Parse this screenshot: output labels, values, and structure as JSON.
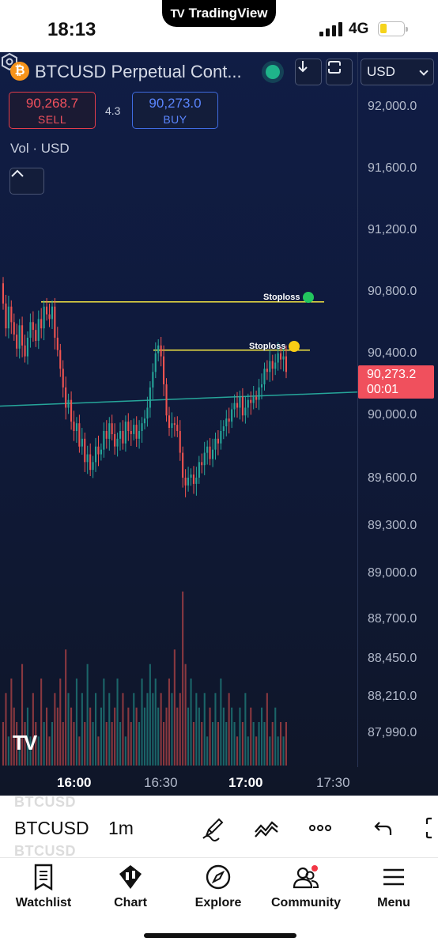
{
  "status_bar": {
    "time": "18:13",
    "island_title": "TradingView",
    "network": "4G"
  },
  "header": {
    "symbol_title": "BTCUSD Perpetual Cont...",
    "coin_glyph": "₿",
    "currency": "USD",
    "sell": {
      "price": "90,268.7",
      "label": "SELL"
    },
    "buy": {
      "price": "90,273.0",
      "label": "BUY"
    },
    "spread": "4.3",
    "vol_label": "Vol · USD"
  },
  "price_axis": {
    "labels": [
      "92,000.0",
      "91,600.0",
      "91,200.0",
      "90,800.0",
      "90,400.0",
      "90,000.0",
      "89,600.0",
      "89,300.0",
      "89,000.0",
      "88,700.0",
      "88,450.0",
      "88,210.0",
      "87,990.0"
    ],
    "current_price": "90,273.2",
    "countdown": "00:01"
  },
  "time_axis": {
    "labels": [
      {
        "text": "16:00",
        "bold": true
      },
      {
        "text": "16:30",
        "bold": false
      },
      {
        "text": "17:00",
        "bold": true
      },
      {
        "text": "17:30",
        "bold": false
      }
    ]
  },
  "annotations": {
    "stoploss_1": {
      "label": "Stoploss",
      "dot_color": "#22c55e"
    },
    "stoploss_2": {
      "label": "Stoploss",
      "dot_color": "#facc15"
    }
  },
  "colors": {
    "up": "#26a69a",
    "down": "#ef5350",
    "stoploss_line": "#f5e642",
    "trendline": "#26a69a",
    "sell": "#f0505d",
    "buy": "#5b86ff"
  },
  "chart_data": {
    "type": "candlestick",
    "series": [
      {
        "name": "BTCUSD",
        "o": [
          90850,
          90720,
          90560,
          90700,
          90600,
          90520,
          90430,
          90580,
          90450,
          90380,
          90500,
          90600,
          90550,
          90480,
          90620,
          90560,
          90700,
          90650,
          90620,
          90700,
          90500,
          90420,
          90300,
          90180,
          90050,
          90100,
          89960,
          89900,
          89950,
          89800,
          89850,
          89700,
          89750,
          89650,
          89700,
          89800,
          89750,
          89780,
          89900,
          89850,
          89950,
          89880,
          89800,
          89850,
          89900,
          89820,
          89960,
          89900,
          89880,
          89940,
          89850,
          89900,
          89950,
          89980,
          90050,
          90180,
          90280,
          90400,
          90450,
          90380,
          90200,
          90000,
          89920,
          89950,
          89940,
          89900,
          89760,
          89600,
          89550,
          89600,
          89620,
          89560,
          89600,
          89700,
          89680,
          89760,
          89800,
          89720,
          89780,
          89850,
          89820,
          89900,
          89930,
          89980,
          89960,
          90040,
          90080,
          90050,
          90120,
          90000,
          90050,
          90100,
          90080,
          90120,
          90100,
          90180,
          90200,
          90300,
          90280,
          90350,
          90300,
          90340,
          90400,
          90360,
          90380
        ],
        "c": [
          90720,
          90560,
          90700,
          90600,
          90520,
          90430,
          90580,
          90450,
          90380,
          90500,
          90600,
          90550,
          90480,
          90620,
          90560,
          90700,
          90650,
          90620,
          90700,
          90500,
          90420,
          90300,
          90180,
          90050,
          90100,
          89960,
          89900,
          89950,
          89800,
          89850,
          89700,
          89750,
          89650,
          89700,
          89800,
          89750,
          89780,
          89900,
          89850,
          89950,
          89880,
          89800,
          89850,
          89900,
          89820,
          89960,
          89900,
          89880,
          89940,
          89850,
          89900,
          89950,
          89980,
          90050,
          90180,
          90280,
          90400,
          90450,
          90380,
          90200,
          90000,
          89920,
          89950,
          89940,
          89900,
          89760,
          89600,
          89550,
          89600,
          89620,
          89560,
          89600,
          89700,
          89680,
          89760,
          89800,
          89720,
          89780,
          89850,
          89820,
          89900,
          89930,
          89980,
          89960,
          90040,
          90080,
          90050,
          90120,
          90000,
          90050,
          90100,
          90080,
          90120,
          90100,
          90180,
          90200,
          90300,
          90280,
          90350,
          90300,
          90340,
          90400,
          90360,
          90380,
          90280
        ]
      }
    ],
    "price_range": [
      87900,
      92100
    ],
    "horizontal_levels": [
      {
        "label": "Stoploss",
        "price": 90730
      },
      {
        "label": "Stoploss",
        "price": 90420
      }
    ],
    "trendline": {
      "from_price": 90060,
      "to_price": 90150
    },
    "volume": [
      3,
      5,
      2,
      6,
      4,
      3,
      2,
      7,
      3,
      4,
      2,
      5,
      3,
      2,
      6,
      3,
      4,
      2,
      3,
      5,
      4,
      6,
      3,
      8,
      5,
      4,
      3,
      6,
      2,
      5,
      3,
      7,
      4,
      3,
      5,
      2,
      4,
      6,
      3,
      5,
      3,
      4,
      6,
      3,
      5,
      2,
      4,
      3,
      5,
      4,
      3,
      6,
      4,
      5,
      7,
      5,
      6,
      4,
      5,
      3,
      4,
      6,
      5,
      8,
      4,
      5,
      12,
      7,
      4,
      6,
      3,
      5,
      4,
      3,
      5,
      2,
      4,
      3,
      5,
      3,
      6,
      4,
      3,
      5,
      4,
      3,
      2,
      4,
      3,
      5,
      2,
      4,
      3,
      2,
      3,
      4,
      3,
      5,
      2,
      3,
      4,
      2,
      3,
      2,
      3
    ]
  },
  "toolbar": {
    "symbol": "BTCUSD",
    "interval": "1m",
    "ghost_symbol": "BTCUSD"
  },
  "nav": {
    "items": [
      {
        "label": "Watchlist",
        "icon": "watchlist-icon"
      },
      {
        "label": "Chart",
        "icon": "chart-icon"
      },
      {
        "label": "Explore",
        "icon": "compass-icon"
      },
      {
        "label": "Community",
        "icon": "community-icon"
      },
      {
        "label": "Menu",
        "icon": "menu-icon"
      }
    ]
  }
}
